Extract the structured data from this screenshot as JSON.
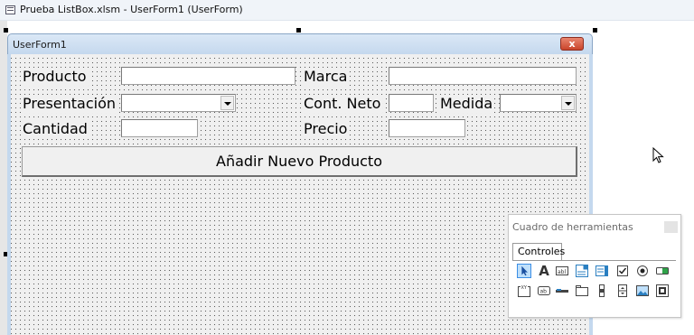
{
  "window": {
    "title": "Prueba ListBox.xlsm - UserForm1 (UserForm)"
  },
  "form": {
    "title": "UserForm1",
    "close_glyph": "x",
    "labels": {
      "producto": "Producto",
      "marca": "Marca",
      "presentacion": "Presentación",
      "cont_neto": "Cont. Neto",
      "medida": "Medida",
      "cantidad": "Cantidad",
      "precio": "Precio"
    },
    "fields": {
      "producto": "",
      "marca": "",
      "presentacion": "",
      "cont_neto": "",
      "medida": "",
      "cantidad": "",
      "precio": ""
    },
    "add_button": "Añadir Nuevo Producto"
  },
  "toolbox": {
    "title": "Cuadro de herramientas",
    "tab": "Controles",
    "tools_row1": [
      "pointer-icon",
      "label-icon",
      "textbox-icon",
      "combobox-icon",
      "listbox-icon",
      "checkbox-icon",
      "optionbutton-icon",
      "togglebutton-icon"
    ],
    "tools_row2": [
      "frame-icon",
      "commandbutton-icon",
      "tabstrip-icon",
      "multipage-icon",
      "scrollbar-icon",
      "spinbutton-icon",
      "image-icon",
      "refedit-icon"
    ],
    "label_glyph": "A",
    "frame_glyph": "XY",
    "button_glyph": "ab"
  },
  "colors": {
    "accent": "#3b8ee6",
    "close": "#c9442b"
  }
}
